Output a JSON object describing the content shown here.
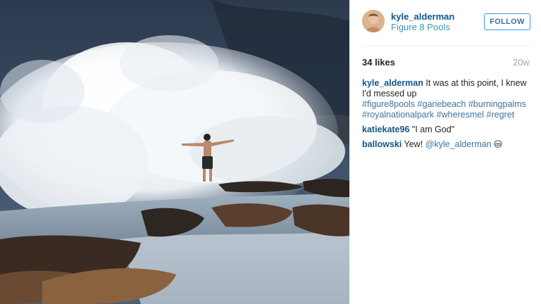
{
  "post": {
    "username": "kyle_alderman",
    "location": "Figure 8 Pools",
    "follow_label": "FOLLOW",
    "likes": "34 likes",
    "age": "20w"
  },
  "caption": {
    "user": "kyle_alderman",
    "text": "It was at this point, I knew I'd messed up",
    "hashtags": [
      "#figure8pools",
      "#gariebeach",
      "#burningpalms",
      "#royalnationalpark",
      "#wheresmel",
      "#regret"
    ]
  },
  "comments": [
    {
      "user": "katiekate96",
      "text": "\"I am God\""
    },
    {
      "user": "ballowski",
      "text": "Yew!",
      "mention": "@kyle_alderman",
      "emoji": "grinning-face-icon"
    }
  ],
  "colors": {
    "username": "#125688",
    "link": "#3f729b",
    "location": "#3897b4",
    "follow_border": "#3897f0",
    "muted": "#a5a7aa"
  }
}
